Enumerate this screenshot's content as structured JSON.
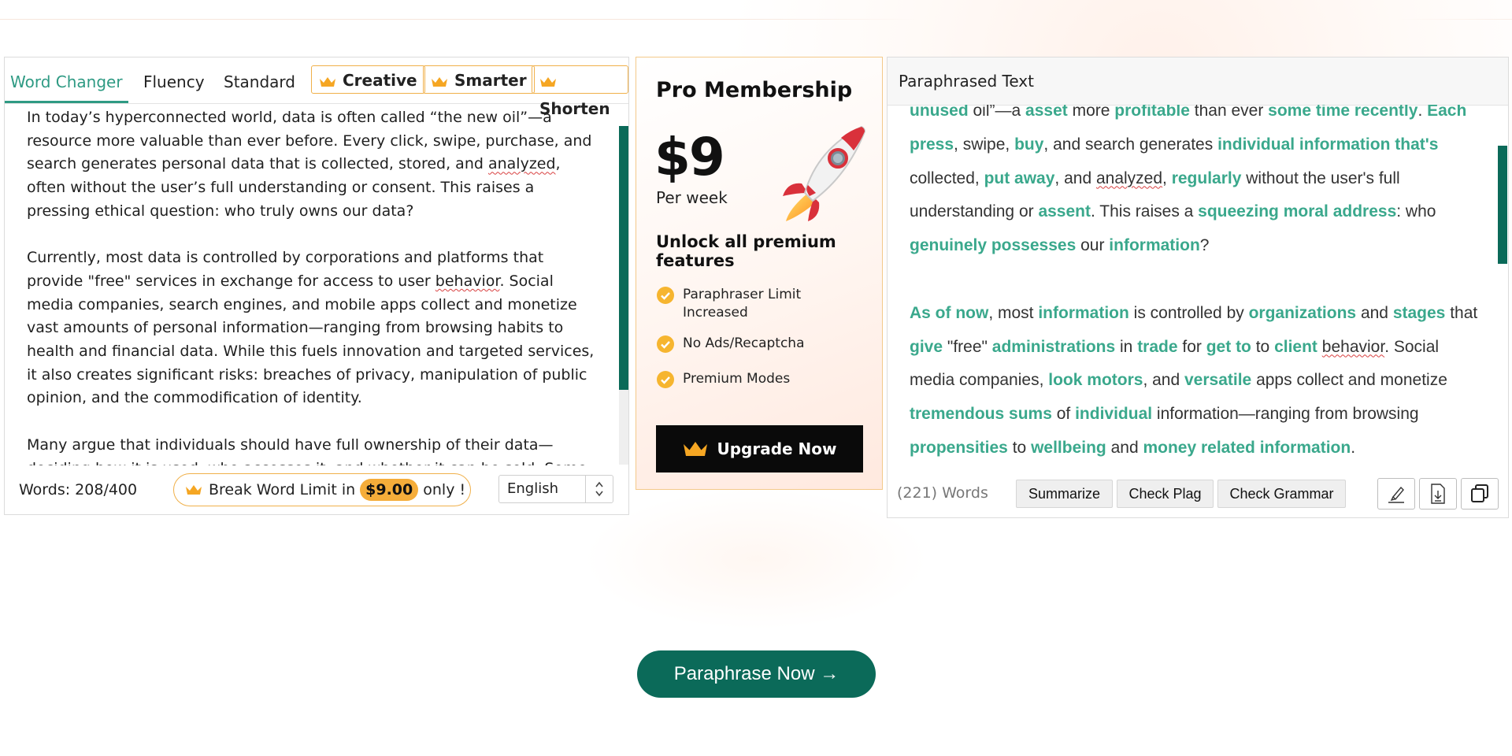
{
  "tabs": [
    {
      "label": "Word Changer",
      "active": true,
      "premium": false
    },
    {
      "label": "Fluency",
      "premium": false
    },
    {
      "label": "Standard",
      "premium": false
    },
    {
      "label": "Creative",
      "premium": true
    },
    {
      "label": "Smarter",
      "premium": true
    },
    {
      "label": "Shorten",
      "premium": true
    }
  ],
  "input": {
    "paragraphs": [
      "In today’s hyperconnected world, data is often called “the new oil”—a resource more valuable than ever before. Every click, swipe, purchase, and search generates personal data that is collected, stored, and analyzed, often without the user’s full understanding or consent. This raises a pressing ethical question: who truly owns our data?",
      "Currently, most data is controlled by corporations and platforms that provide \"free\" services in exchange for access to user behavior. Social media companies, search engines, and mobile apps collect and monetize vast amounts of personal information—ranging from browsing habits to health and financial data. While this fuels innovation and targeted services, it also creates significant risks: breaches of privacy, manipulation of public opinion, and the commodification of identity.",
      "Many argue that individuals should have full ownership of their data—deciding how it is used, who accesses it, and whether it can be sold. Some"
    ],
    "word_count": "Words: 208/400",
    "break_limit_prefix": "Break Word Limit in",
    "break_limit_price": "$9.00",
    "break_limit_suffix": "only !",
    "language": "English"
  },
  "pro": {
    "title": "Pro Membership",
    "price": "$9",
    "period": "Per week",
    "unlock": "Unlock all premium features",
    "features": [
      "Paraphraser Limit Increased",
      "No Ads/Recaptcha",
      "Premium Modes"
    ],
    "upgrade_label": "Upgrade Now"
  },
  "output": {
    "header": "Paraphrased Text",
    "paragraphs": [
      [
        {
          "t": "unused",
          "h": true
        },
        {
          "t": " oil”—a "
        },
        {
          "t": "asset",
          "h": true
        },
        {
          "t": " more "
        },
        {
          "t": "profitable",
          "h": true
        },
        {
          "t": " than ever "
        },
        {
          "t": "some time recently",
          "h": true
        },
        {
          "t": ". "
        },
        {
          "t": "Each press",
          "h": true
        },
        {
          "t": ", swipe, "
        },
        {
          "t": "buy",
          "h": true
        },
        {
          "t": ", and search generates "
        },
        {
          "t": "individual information that's",
          "h": true
        },
        {
          "t": " collected, "
        },
        {
          "t": "put away",
          "h": true
        },
        {
          "t": ", and "
        },
        {
          "t": "analyzed",
          "sq": true
        },
        {
          "t": ", "
        },
        {
          "t": "regularly",
          "h": true
        },
        {
          "t": " without the user's full understanding or "
        },
        {
          "t": "assent",
          "h": true
        },
        {
          "t": ". This raises a "
        },
        {
          "t": "squeezing moral address",
          "h": true
        },
        {
          "t": ": who "
        },
        {
          "t": "genuinely possesses",
          "h": true
        },
        {
          "t": " our "
        },
        {
          "t": "information",
          "h": true
        },
        {
          "t": "?"
        }
      ],
      [
        {
          "t": "As of now",
          "h": true
        },
        {
          "t": ", most "
        },
        {
          "t": "information",
          "h": true
        },
        {
          "t": " is controlled by "
        },
        {
          "t": "organizations",
          "h": true
        },
        {
          "t": " and "
        },
        {
          "t": "stages",
          "h": true
        },
        {
          "t": " that "
        },
        {
          "t": "give",
          "h": true
        },
        {
          "t": " \"free\" "
        },
        {
          "t": "administrations",
          "h": true
        },
        {
          "t": " in "
        },
        {
          "t": "trade",
          "h": true
        },
        {
          "t": " for "
        },
        {
          "t": "get to",
          "h": true
        },
        {
          "t": " to "
        },
        {
          "t": "client",
          "h": true
        },
        {
          "t": " "
        },
        {
          "t": "behavior",
          "sq": true
        },
        {
          "t": ". Social media companies, "
        },
        {
          "t": "look motors",
          "h": true
        },
        {
          "t": ", and "
        },
        {
          "t": "versatile",
          "h": true
        },
        {
          "t": " apps collect and monetize "
        },
        {
          "t": "tremendous sums",
          "h": true
        },
        {
          "t": " of "
        },
        {
          "t": "individual",
          "h": true
        },
        {
          "t": " information—ranging from browsing "
        },
        {
          "t": "propensities",
          "h": true
        },
        {
          "t": " to "
        },
        {
          "t": "wellbeing",
          "h": true
        },
        {
          "t": " and "
        },
        {
          "t": "money related information",
          "h": true
        },
        {
          "t": "."
        }
      ]
    ],
    "word_count": "(221) Words",
    "summarize_label": "Summarize",
    "check_plag_label": "Check Plag",
    "check_grammar_label": "Check Grammar"
  },
  "paraphrase_button": "Paraphrase Now →",
  "colors": {
    "accent": "#0b6a59",
    "highlight": "#3aa88c",
    "gold": "#f5ad3a"
  }
}
